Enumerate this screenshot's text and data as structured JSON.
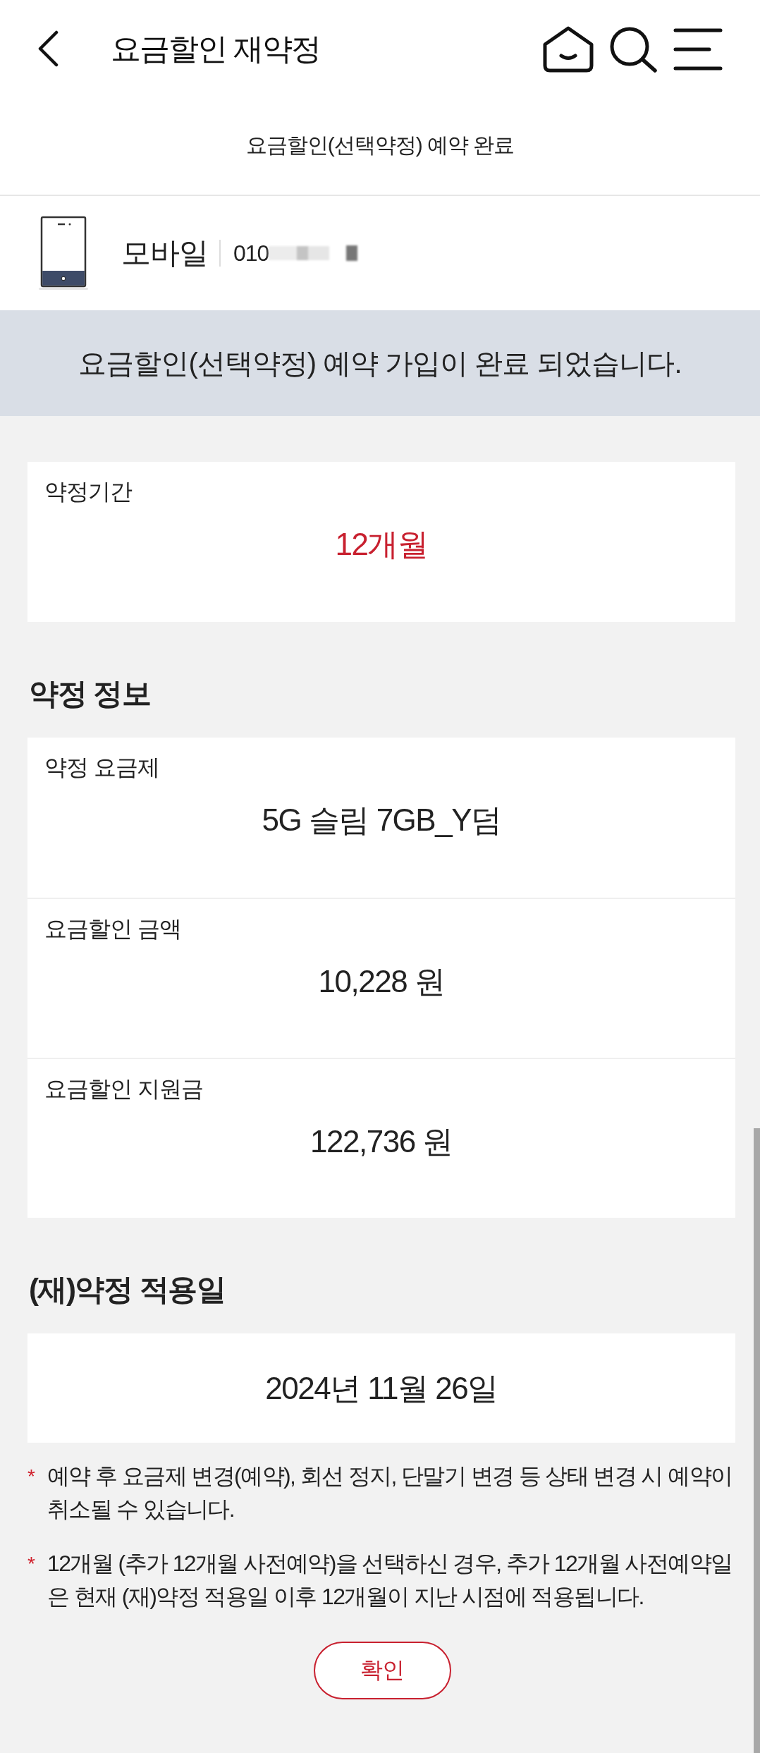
{
  "header": {
    "title": "요금할인 재약정"
  },
  "subtitle": "요금할인(선택약정) 예약 완료",
  "line": {
    "type": "모바일",
    "number": "010"
  },
  "banner": "요금할인(선택약정) 예약 가입이 완료 되었습니다.",
  "period": {
    "label": "약정기간",
    "value": "12개월"
  },
  "sections": [
    {
      "title": "약정 정보",
      "rows": [
        {
          "label": "약정 요금제",
          "value": "5G 슬림 7GB_Y덤"
        },
        {
          "label": "요금할인 금액",
          "value": "10,228 원"
        },
        {
          "label": "요금할인 지원금",
          "value": "122,736 원"
        }
      ]
    },
    {
      "title": "(재)약정 적용일",
      "rows": [
        {
          "value": "2024년 11월 26일"
        }
      ]
    }
  ],
  "notes": [
    {
      "marker": "*",
      "text": "예약 후 요금제 변경(예약), 회선 정지, 단말기 변경 등 상태 변경 시 예약이 취소될 수 있습니다."
    },
    {
      "marker": "*",
      "text": "12개월 (추가 12개월 사전예약)을 선택하신 경우, 추가 12개월 사전예약일은 현재 (재)약정 적용일 이후 12개월이 지난 시점에 적용됩니다."
    }
  ],
  "confirm_button": "확인"
}
